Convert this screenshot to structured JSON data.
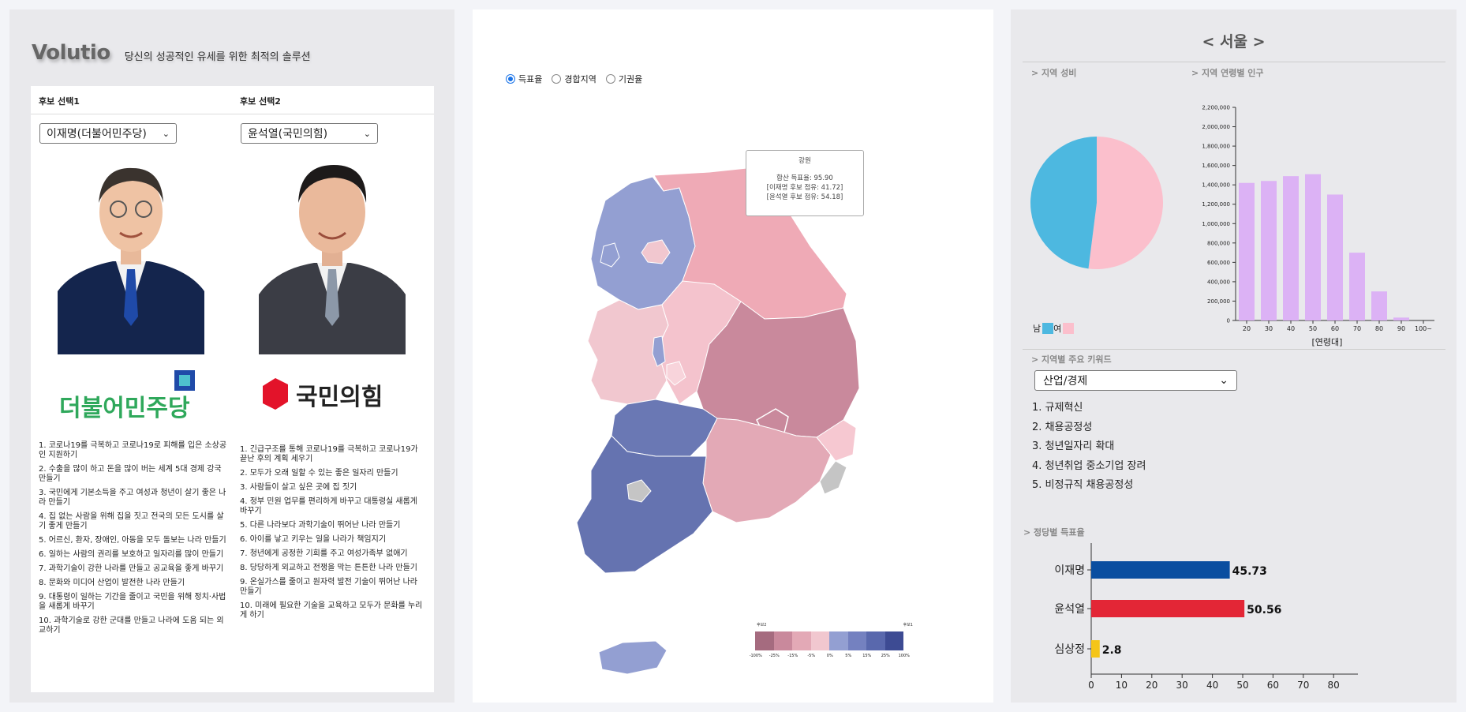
{
  "brand": {
    "logo_text": "Volutio",
    "tagline": "당신의 성공적인 유세를 위한 최적의 솔루션"
  },
  "candidates": {
    "header1": "후보 선택1",
    "header2": "후보 선택2",
    "cand1": {
      "selected": "이재명(더불어민주당)",
      "party": "더불어민주당",
      "pledges": [
        "1. 코로나19를 극복하고 코로나19로 피해를 입은 소상공인 지원하기",
        "2. 수출을 많이 하고 돈을 많이 버는 세계 5대 경제 강국 만들기",
        "3. 국민에게 기본소득을 주고 여성과 청년이 살기 좋은 나라 만들기",
        "4. 집 없는 사람을 위해 집을 짓고 전국의 모든 도시를 살기 좋게 만들기",
        "5. 어르신, 환자, 장애인, 아동을 모두 돌보는 나라 만들기",
        "6. 일하는 사람의 권리를 보호하고 일자리를 많이 만들기",
        "7. 과학기술이 강한 나라를 만들고 공교육을 좋게 바꾸기",
        "8. 문화와 미디어 산업이 발전한 나라 만들기",
        "9. 대통령이 일하는 기간을 줄이고 국민을 위해 정치·사법을 새롭게 바꾸기",
        "10. 과학기술로 강한 군대를 만들고 나라에 도움 되는 외교하기"
      ]
    },
    "cand2": {
      "selected": "윤석열(국민의힘)",
      "party": "국민의힘",
      "pledges": [
        "1. 긴급구조를 통해 코로나19를 극복하고 코로나19가 끝난 후의 계획 세우기",
        "2. 모두가 오래 일할 수 있는 좋은 일자리 만들기",
        "3. 사람들이 살고 싶은 곳에 집 짓기",
        "4. 정부 민원 업무를 편리하게 바꾸고 대통령실 새롭게 바꾸기",
        "5. 다른 나라보다 과학기술이 뛰어난 나라 만들기",
        "6. 아이를 낳고 키우는 일을 나라가 책임지기",
        "7. 청년에게 공정한 기회를 주고 여성가족부 없애기",
        "8. 당당하게 외교하고 전쟁을 막는 튼튼한 나라 만들기",
        "9. 온실가스를 줄이고 원자력 발전 기술이 뛰어난 나라 만들기",
        "10. 미래에 필요한 기술을 교육하고 모두가 문화를 누리게 하기"
      ]
    }
  },
  "map_controls": {
    "radios": [
      {
        "label": "득표율",
        "checked": true
      },
      {
        "label": "경합지역",
        "checked": false
      },
      {
        "label": "기권율",
        "checked": false
      }
    ]
  },
  "tooltip": {
    "region": "강원",
    "line1": "합산 득표율: 95.90",
    "line2": "[이재명 후보 점유: 41.72]",
    "line3": "[윤석열 후보 점유: 54.18]"
  },
  "map_legend": {
    "left_label": "후보2",
    "right_label": "후보1",
    "colors": [
      "#a56b7f",
      "#c9899c",
      "#e3a9b6",
      "#f1c7cf",
      "#939fd2",
      "#7481c0",
      "#5968ad",
      "#3d4b93"
    ],
    "ticks": [
      "-100%",
      "-25%",
      "-15%",
      "-5%",
      "0%",
      "5%",
      "15%",
      "25%",
      "100%"
    ]
  },
  "right": {
    "region_title": "< 서울 >",
    "sex_ratio_label": "> 지역 성비",
    "age_pop_label": "> 지역 연령별 인구",
    "keywords_label": "> 지역별 주요 키워드",
    "keyword_category": "산업/경제",
    "keywords": [
      "1. 규제혁신",
      "2. 채용공정성",
      "3. 청년일자리 확대",
      "4. 청년취업 중소기업 장려",
      "5. 비정규직 채용공정성"
    ],
    "party_votes_label": "> 정당별 득표율",
    "sex_legend_male": "남",
    "sex_legend_female": "여",
    "colors": {
      "male": "#4db8e0",
      "female": "#fbbfcc",
      "age_bar": "#dcb2f5"
    }
  },
  "chart_data": [
    {
      "type": "pie",
      "labels": [
        "남",
        "여"
      ],
      "values": [
        48.0,
        52.0
      ],
      "colors": [
        "#4db8e0",
        "#fbbfcc"
      ]
    },
    {
      "type": "bar",
      "categories": [
        "20",
        "30",
        "40",
        "50",
        "60",
        "70",
        "80",
        "90",
        "100~"
      ],
      "values": [
        1420000,
        1440000,
        1490000,
        1510000,
        1300000,
        700000,
        300000,
        30000,
        0
      ],
      "ylim": [
        0,
        2200000
      ],
      "yticks": [
        "0",
        "200,000",
        "400,000",
        "600,000",
        "800,000",
        "1,000,000",
        "1,200,000",
        "1,400,000",
        "1,600,000",
        "1,800,000",
        "2,000,000",
        "2,200,000"
      ],
      "xlabel": "[연령대]"
    },
    {
      "type": "bar",
      "orientation": "horizontal",
      "categories": [
        "이재명",
        "윤석열",
        "심상정"
      ],
      "values": [
        45.73,
        50.56,
        2.8
      ],
      "colors": [
        "#0a4ea0",
        "#e32636",
        "#f5c518"
      ],
      "xlim": [
        0,
        100
      ],
      "xticks": [
        "0",
        "10",
        "20",
        "30",
        "40",
        "50",
        "60",
        "70",
        "80",
        "90",
        "100"
      ]
    }
  ]
}
